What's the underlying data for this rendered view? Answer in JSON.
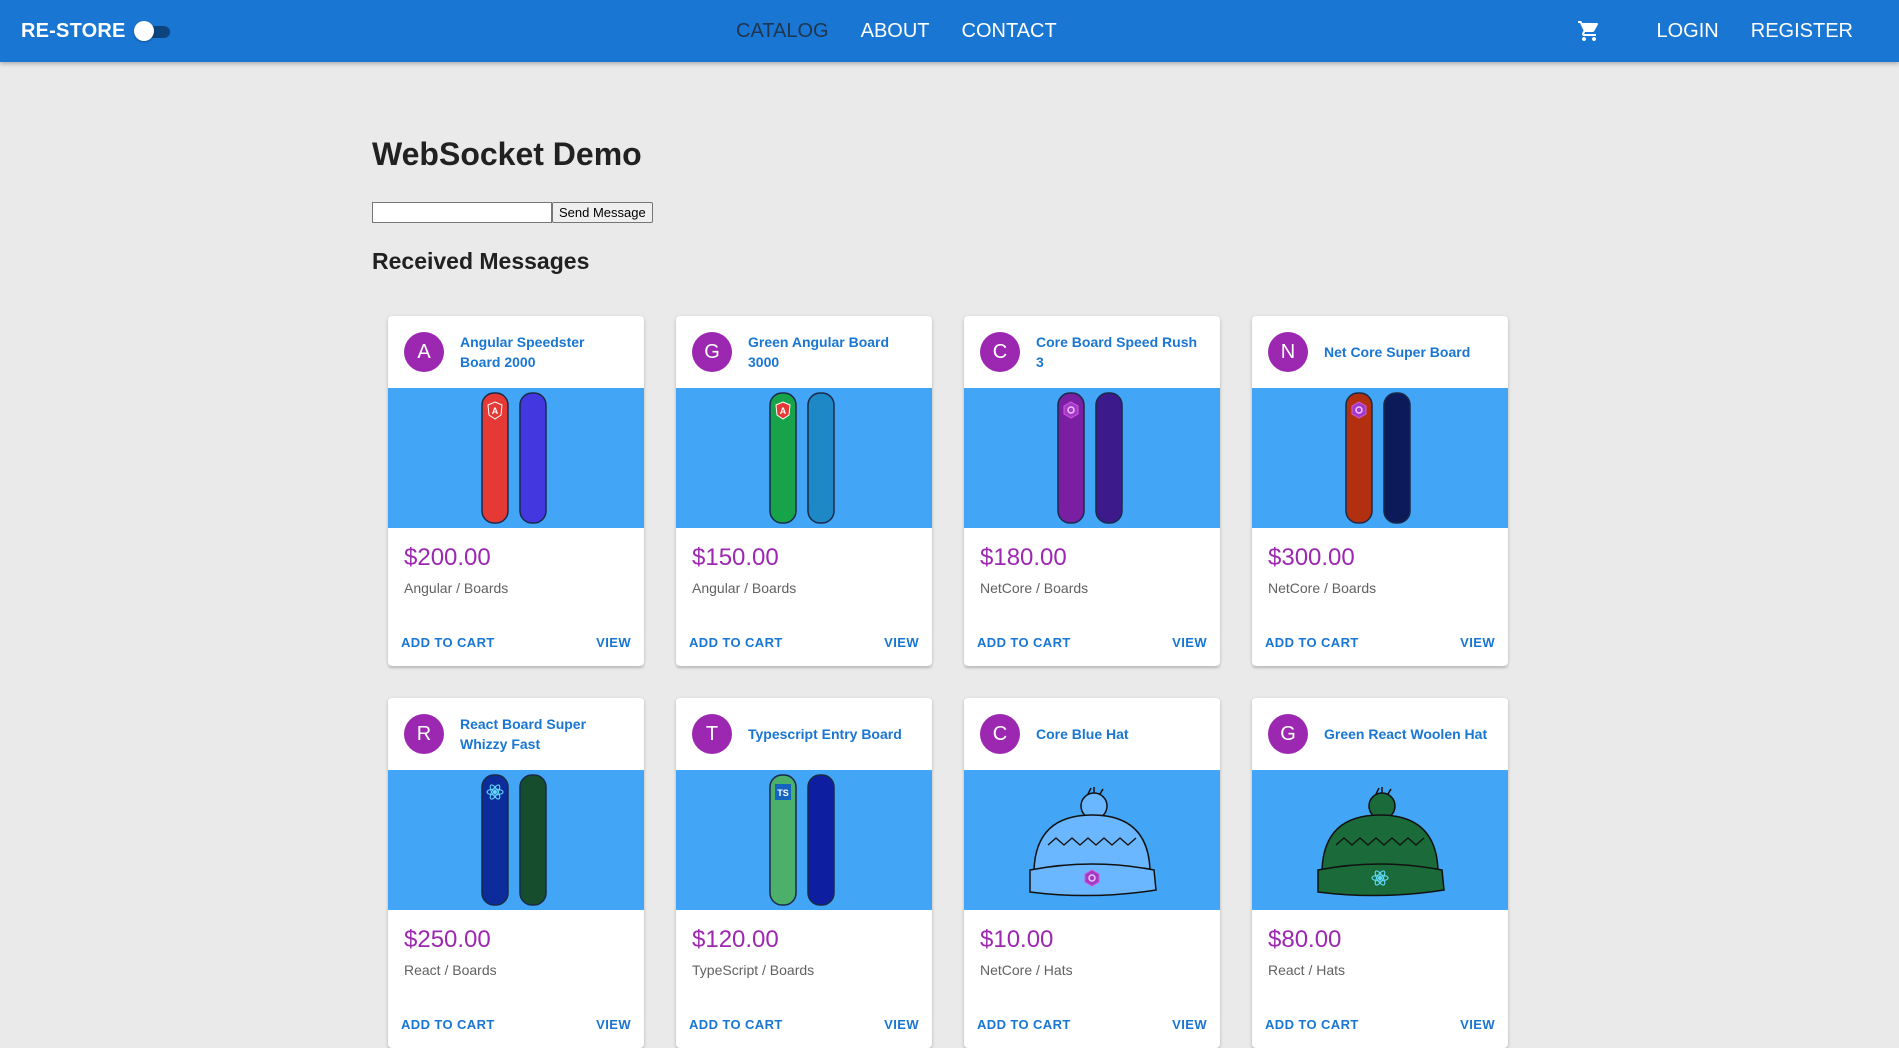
{
  "appbar": {
    "title": "RE-STORE",
    "nav": [
      {
        "label": "CATALOG",
        "active": true
      },
      {
        "label": "ABOUT",
        "active": false
      },
      {
        "label": "CONTACT",
        "active": false
      }
    ],
    "cart_icon": "shopping-cart-icon",
    "right_nav": [
      "LOGIN",
      "REGISTER"
    ],
    "color": "#1976d2"
  },
  "main": {
    "title": "WebSocket Demo",
    "message_input": {
      "value": "",
      "placeholder": ""
    },
    "send_button": "Send Message",
    "received_title": "Received Messages"
  },
  "products": [
    {
      "initial": "A",
      "name": "Angular Speedster Board 2000",
      "price": "$200.00",
      "meta": "Angular / Boards",
      "add": "ADD TO CART",
      "view": "VIEW",
      "image": "snowboard",
      "colors": [
        "#e53935",
        "#4338e0"
      ],
      "logo": "angular"
    },
    {
      "initial": "G",
      "name": "Green Angular Board 3000",
      "price": "$150.00",
      "meta": "Angular / Boards",
      "add": "ADD TO CART",
      "view": "VIEW",
      "image": "snowboard",
      "colors": [
        "#16a34a",
        "#1e88c7"
      ],
      "logo": "angular"
    },
    {
      "initial": "C",
      "name": "Core Board Speed Rush 3",
      "price": "$180.00",
      "meta": "NetCore / Boards",
      "add": "ADD TO CART",
      "view": "VIEW",
      "image": "snowboard",
      "colors": [
        "#7b1fa2",
        "#3d1a8c"
      ],
      "logo": "netcore"
    },
    {
      "initial": "N",
      "name": "Net Core Super Board",
      "price": "$300.00",
      "meta": "NetCore / Boards",
      "add": "ADD TO CART",
      "view": "VIEW",
      "image": "snowboard",
      "colors": [
        "#b23010",
        "#0d1a5a"
      ],
      "logo": "netcore"
    },
    {
      "initial": "R",
      "name": "React Board Super Whizzy Fast",
      "price": "$250.00",
      "meta": "React / Boards",
      "add": "ADD TO CART",
      "view": "VIEW",
      "image": "snowboard",
      "colors": [
        "#0d2c9c",
        "#164d2c"
      ],
      "logo": "react"
    },
    {
      "initial": "T",
      "name": "Typescript Entry Board",
      "price": "$120.00",
      "meta": "TypeScript / Boards",
      "add": "ADD TO CART",
      "view": "VIEW",
      "image": "snowboard",
      "colors": [
        "#4caf6a",
        "#0d1fa0"
      ],
      "logo": "ts"
    },
    {
      "initial": "C",
      "name": "Core Blue Hat",
      "price": "$10.00",
      "meta": "NetCore / Hats",
      "add": "ADD TO CART",
      "view": "VIEW",
      "image": "hat",
      "colors": [
        "#6ab7ff",
        "#6ab7ff"
      ],
      "logo": "netcore"
    },
    {
      "initial": "G",
      "name": "Green React Woolen Hat",
      "price": "$80.00",
      "meta": "React / Hats",
      "add": "ADD TO CART",
      "view": "VIEW",
      "image": "hat",
      "colors": [
        "#1b6b3a",
        "#1b6b3a"
      ],
      "logo": "react"
    }
  ]
}
